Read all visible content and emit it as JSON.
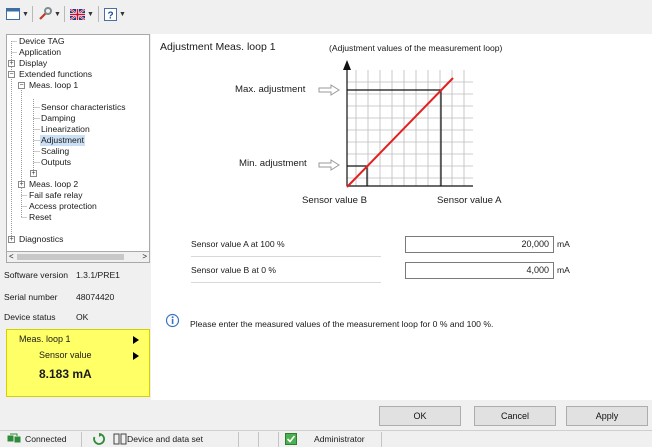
{
  "toolbar": {
    "buttons": [
      "view-menu",
      "tools-menu",
      "language-menu",
      "help-menu"
    ]
  },
  "tree": {
    "items": [
      {
        "label": "Device TAG"
      },
      {
        "label": "Application"
      },
      {
        "label": "Display"
      },
      {
        "label": "Extended functions"
      },
      {
        "label": "Meas. loop 1"
      },
      {
        "label": "Sensor characteristics"
      },
      {
        "label": "Damping"
      },
      {
        "label": "Linearization"
      },
      {
        "label": "Adjustment"
      },
      {
        "label": "Scaling"
      },
      {
        "label": "Outputs"
      },
      {
        "label": "Meas. loop 2"
      },
      {
        "label": "Fail safe relay"
      },
      {
        "label": "Access protection"
      },
      {
        "label": "Reset"
      },
      {
        "label": "Diagnostics"
      }
    ],
    "expand_plus": "+",
    "expand_minus": "−",
    "scroll_left": "<",
    "scroll_right": ">"
  },
  "device_info": {
    "software_version_label": "Software version",
    "software_version_value": "1.3.1/PRE1",
    "serial_number_label": "Serial number",
    "serial_number_value": "48074420",
    "device_status_label": "Device status",
    "device_status_value": "OK"
  },
  "status_box": {
    "loop_label": "Meas. loop 1",
    "sensor_label": "Sensor value",
    "value": "8.183 mA",
    "color": "#ffff66"
  },
  "main": {
    "title": "Adjustment Meas. loop 1",
    "subtitle": "(Adjustment values of the measurement loop)",
    "max_adjustment": "Max. adjustment",
    "min_adjustment": "Min. adjustment",
    "sensor_value_b": "Sensor value B",
    "sensor_value_a": "Sensor value A",
    "field_a_label": "Sensor value A at 100 %",
    "field_a_value": "20,000",
    "field_a_unit": "mA",
    "field_b_label": "Sensor value B at 0 %",
    "field_b_value": "4,000",
    "field_b_unit": "mA",
    "hint": "Please enter the measured values of the measurement loop for 0 % and 100 %."
  },
  "buttons": {
    "ok": "OK",
    "cancel": "Cancel",
    "apply": "Apply"
  },
  "statusbar": {
    "connected": "Connected",
    "device_dataset": "Device and data set",
    "user": "Administrator"
  },
  "colors": {
    "line": "#e32020",
    "selection": "#cce0f5"
  }
}
